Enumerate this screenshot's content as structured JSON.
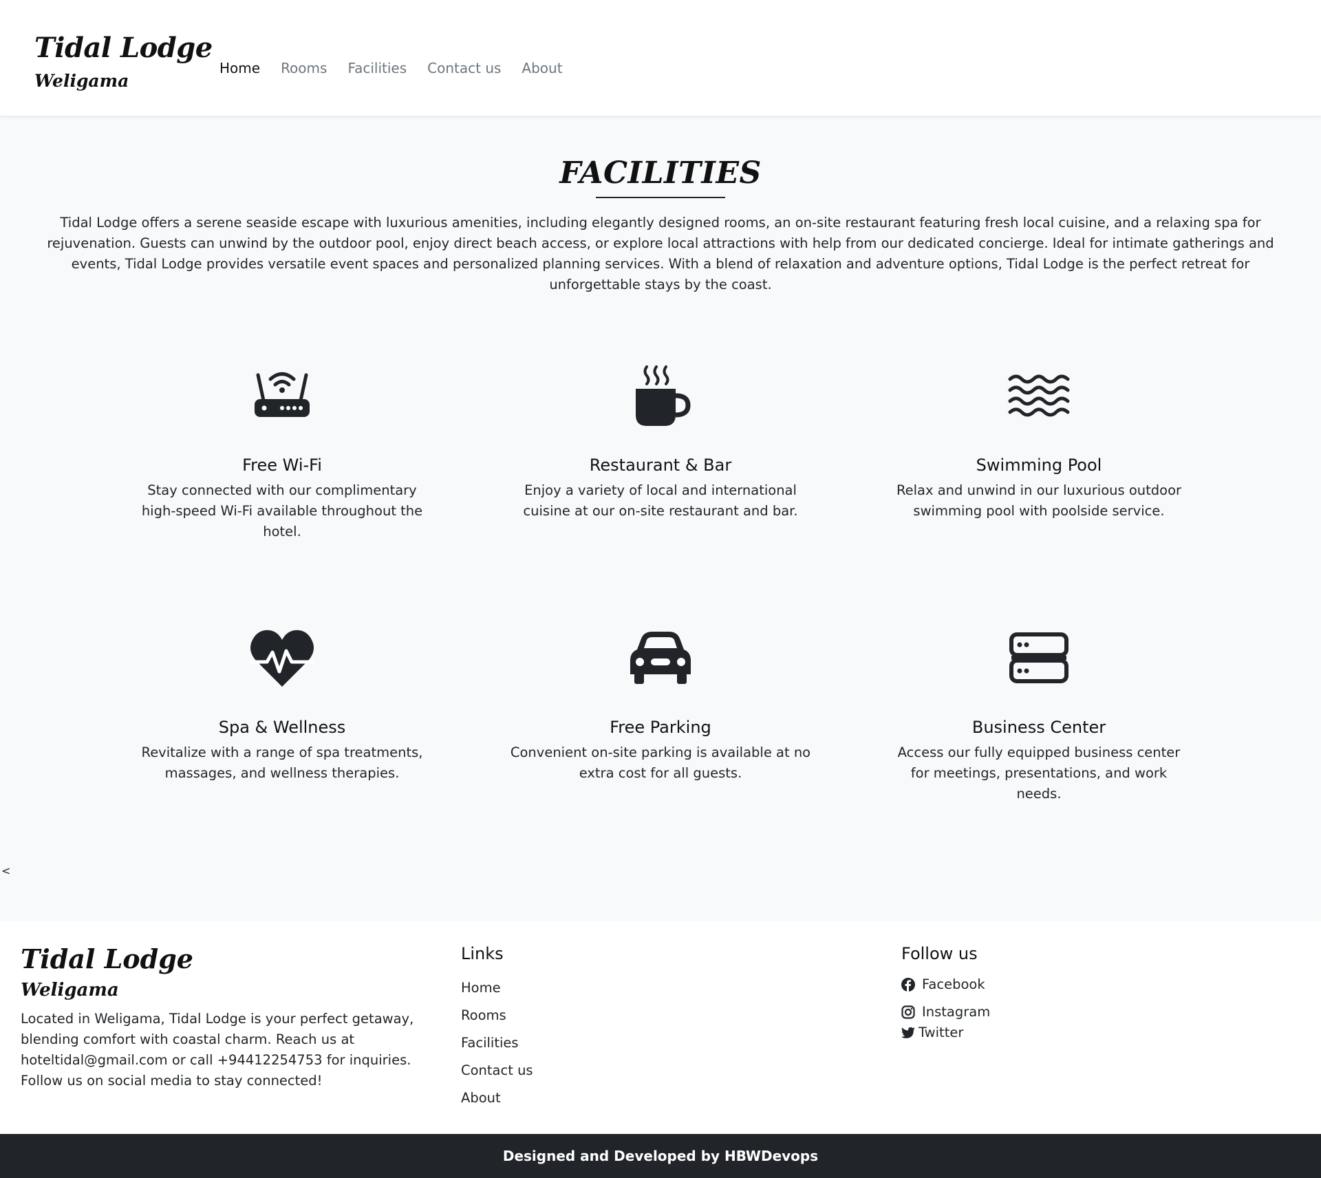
{
  "navbar": {
    "brand": "Tidal Lodge",
    "brand_sub": "Weligama",
    "links": [
      "Home",
      "Rooms",
      "Facilities",
      "Contact us",
      "About"
    ],
    "active": "Home"
  },
  "facilities": {
    "title": "FACILITIES",
    "intro": "Tidal Lodge offers a serene seaside escape with luxurious amenities, including elegantly designed rooms, an on-site restaurant featuring fresh local cuisine, and a relaxing spa for rejuvenation. Guests can unwind by the outdoor pool, enjoy direct beach access, or explore local attractions with help from our dedicated concierge. Ideal for intimate gatherings and events, Tidal Lodge provides versatile event spaces and personalized planning services. With a blend of relaxation and adventure options, Tidal Lodge is the perfect retreat for unforgettable stays by the coast.",
    "items": [
      {
        "icon": "router-icon",
        "title": "Free Wi-Fi",
        "text": "Stay connected with our complimentary high-speed Wi-Fi available throughout the hotel."
      },
      {
        "icon": "hot-cup-icon",
        "title": "Restaurant & Bar",
        "text": "Enjoy a variety of local and international cuisine at our on-site restaurant and bar."
      },
      {
        "icon": "water-waves-icon",
        "title": "Swimming Pool",
        "text": "Relax and unwind in our luxurious outdoor swimming pool with poolside service."
      },
      {
        "icon": "heart-pulse-icon",
        "title": "Spa & Wellness",
        "text": "Revitalize with a range of spa treatments, massages, and wellness therapies."
      },
      {
        "icon": "car-icon",
        "title": "Free Parking",
        "text": "Convenient on-site parking is available at no extra cost for all guests."
      },
      {
        "icon": "server-icon",
        "title": "Business Center",
        "text": "Access our fully equipped business center for meetings, presentations, and work needs."
      }
    ]
  },
  "stray_glyphs": [
    "<",
    "<"
  ],
  "footer": {
    "brand": "Tidal Lodge",
    "brand_sub": "Weligama",
    "description": "Located in Weligama, Tidal Lodge is your perfect getaway, blending comfort with coastal charm. Reach us at hoteltidal@gmail.com or call +94412254753 for inquiries. Follow us on social media to stay connected!",
    "links_title": "Links",
    "links": [
      "Home",
      "Rooms",
      "Facilities",
      "Contact us",
      "About"
    ],
    "follow_title": "Follow us",
    "social": [
      {
        "icon": "facebook-icon",
        "label": "Facebook"
      },
      {
        "icon": "instagram-icon",
        "label": "Instagram"
      },
      {
        "icon": "twitter-icon",
        "label": "Twitter"
      }
    ],
    "credit": "Designed and Developed by HBWDevops"
  },
  "colors": {
    "page_bg": "#f8f9fa",
    "text": "#212529",
    "nav_muted": "#6c757d",
    "bottom_bar": "#212529"
  }
}
